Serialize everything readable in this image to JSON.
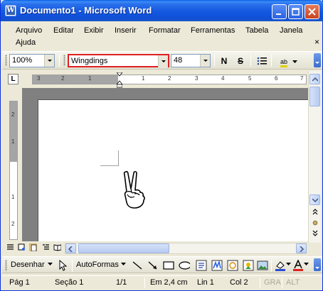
{
  "window": {
    "title": "Documento1 - Microsoft Word",
    "app_icon": "word-icon",
    "controls": [
      "minimize-icon",
      "maximize-icon",
      "close-icon"
    ]
  },
  "menu": {
    "items": [
      "Arquivo",
      "Editar",
      "Exibir",
      "Inserir",
      "Formatar",
      "Ferramentas",
      "Tabela",
      "Janela",
      "Ajuda"
    ],
    "close_glyph": "×"
  },
  "formatting": {
    "zoom": "100%",
    "font": "Wingdings",
    "size": "48",
    "bold_label": "N",
    "strike_label": "S",
    "highlight_label": "ab"
  },
  "ruler": {
    "tab_selector": "L",
    "h_numbers": [
      "3",
      "2",
      "1",
      "1",
      "2",
      "3",
      "4",
      "5",
      "6",
      "7"
    ],
    "v_numbers": [
      "2",
      "1",
      "1",
      "2"
    ]
  },
  "document": {
    "glyph": "victory-hand-icon"
  },
  "drawing": {
    "desenhar": "Desenhar",
    "autoformas": "AutoFormas"
  },
  "status": {
    "page": "Pág 1",
    "section": "Seção 1",
    "pages": "1/1",
    "at": "Em 2,4 cm",
    "line": "Lin 1",
    "col": "Col 2",
    "rec": "GRA",
    "ovr": "ALT"
  },
  "colors": {
    "title_blue": "#0F4FD6",
    "highlight_red": "#E02020",
    "chrome": "#ECE9D8"
  }
}
